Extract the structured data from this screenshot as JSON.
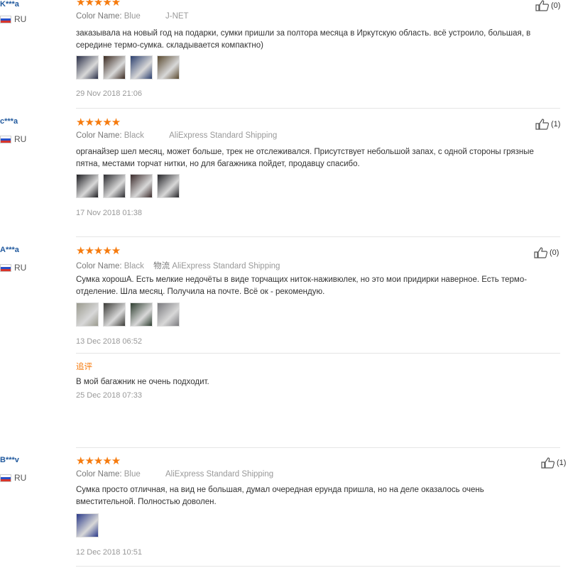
{
  "reviews": [
    {
      "user": "K***a",
      "country": "RU",
      "stars": "★★★★★",
      "meta_label": "Color Name:",
      "color": "Blue",
      "shipping": "J-NET",
      "text": "заказывала на новый год на подарки, сумки пришли за полтора месяца в Иркутскую область. всё устроило, большая, в середине термо-сумка. складывается компактно)",
      "date": "29 Nov 2018 21:06",
      "likes": "(0)",
      "thumb_colors": [
        "#2a2f48",
        "#3b2a20",
        "#2b3f6e",
        "#5a4a30"
      ]
    },
    {
      "user": "c***a",
      "country": "RU",
      "stars": "★★★★★",
      "meta_label": "Color Name:",
      "color": "Black",
      "shipping": "AliExpress Standard Shipping",
      "text": "органайзер шел месяц, может больше, трек не отслеживался. Присутствует небольшой запах, с одной стороны грязные пятна, местами торчат нитки, но для багажника пойдет, продавцу спасибо.",
      "date": "17 Nov 2018 01:38",
      "likes": "(1)",
      "thumb_colors": [
        "#1e1e22",
        "#2c2c30",
        "#3a2a2a",
        "#242428"
      ]
    },
    {
      "user": "A***a",
      "country": "RU",
      "stars": "★★★★★",
      "meta_label": "Color Name:",
      "color": "Black",
      "shipping_prefix": "物流",
      "shipping": "AliExpress Standard Shipping",
      "text": "Сумка хорошА. Есть мелкие недочёты в виде торчащих ниток-наживюлек, но это мои придирки наверное. Есть термо-отделение. Шла месяц. Получила на почте. Всё ок - рекомендую.",
      "date": "13 Dec 2018 06:52",
      "likes": "(0)",
      "thumb_colors": [
        "#9a9a8e",
        "#3a3a36",
        "#2e3e30",
        "#7a7a7e"
      ],
      "additional_label": "追评",
      "additional_text": "В мой багажник не очень подходит.",
      "additional_date": "25 Dec 2018 07:33"
    },
    {
      "user": "B***v",
      "country": "RU",
      "stars": "★★★★★",
      "meta_label": "Color Name:",
      "color": "Blue",
      "shipping": "AliExpress Standard Shipping",
      "text": "Сумка просто отличная, на вид не большая, думал очередная ерунда пришла, но на деле оказалось очень вместительной. Полностью доволен.",
      "date": "12 Dec 2018 10:51",
      "likes": "(1)",
      "thumb_colors": [
        "#2a3a8a"
      ]
    }
  ]
}
